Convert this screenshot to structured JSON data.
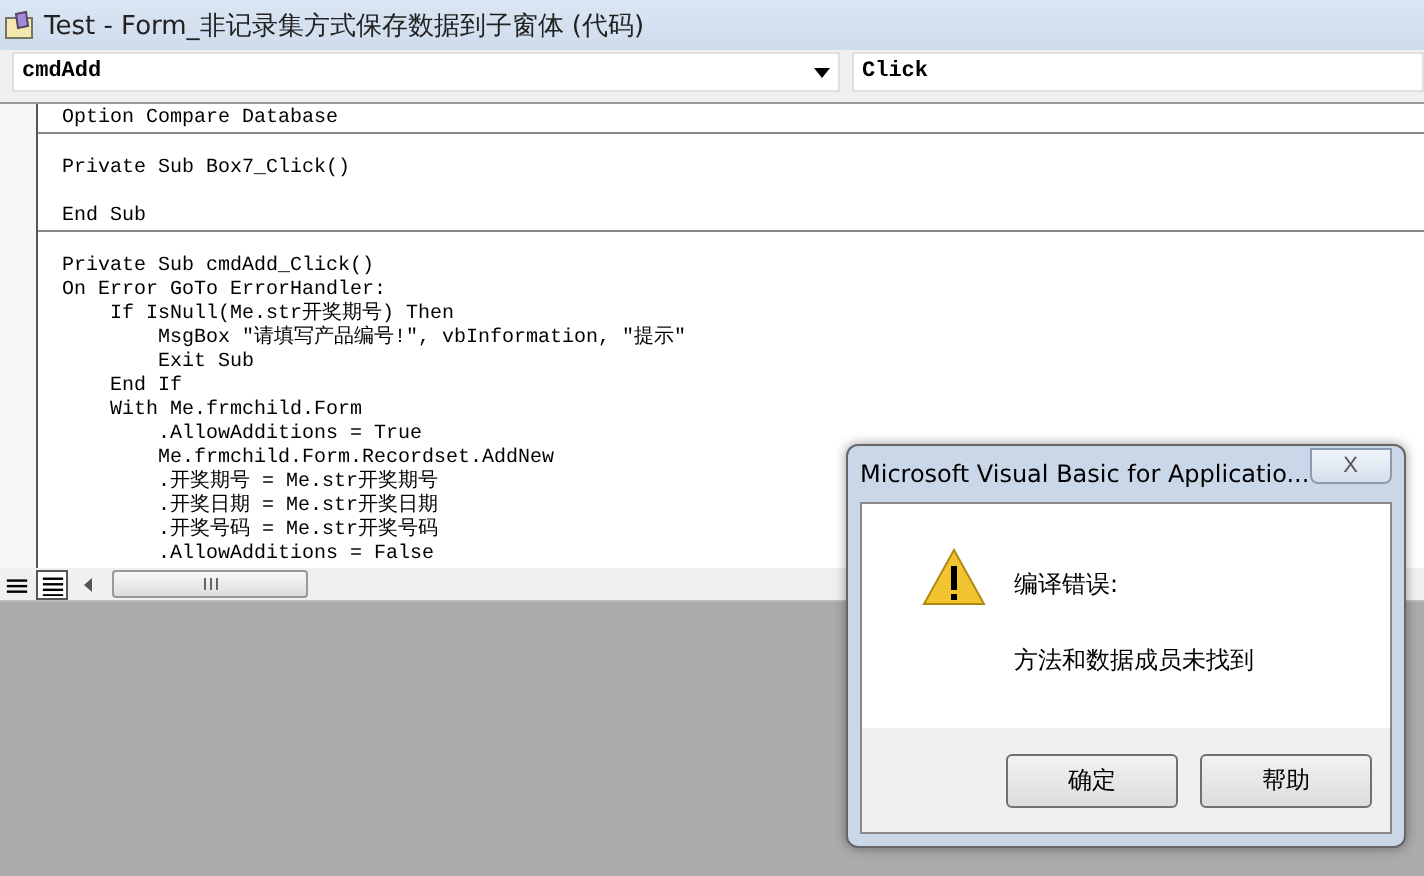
{
  "window": {
    "title": "Test - Form_非记录集方式保存数据到子窗体 (代码)"
  },
  "object_combo": {
    "value": "cmdAdd"
  },
  "procedure_combo": {
    "value": "Click"
  },
  "procedures": [
    {
      "lines": [
        {
          "kind": "code",
          "text": "Option Compare Database"
        }
      ]
    },
    {
      "lines": [
        {
          "kind": "blank"
        },
        {
          "kind": "code",
          "text": "Private Sub Box7_Click()"
        },
        {
          "kind": "blank"
        },
        {
          "kind": "code",
          "text": "End Sub"
        }
      ]
    },
    {
      "lines": [
        {
          "kind": "blank"
        },
        "Private Sub cmdAdd_Click()",
        "On Error GoTo ErrorHandler:",
        "    If IsNull(Me.str开奖期号) Then",
        "        MsgBox \"请填写产品编号!\", vbInformation, \"提示\"",
        "        Exit Sub",
        "    End If",
        "    With Me.frmchild.Form",
        "        .AllowAdditions = True",
        "        Me.frmchild.Form.Recordset.AddNew",
        "        .开奖期号 = Me.str开奖期号",
        "        .开奖日期 = Me.str开奖日期",
        "        .开奖号码 = Me.str开奖号码",
        "        .AllowAdditions = False"
      ]
    }
  ],
  "view_buttons": [
    {
      "kind": "procedure",
      "selected": false
    },
    {
      "kind": "module",
      "selected": true
    }
  ],
  "dialog": {
    "title": "Microsoft Visual Basic for Applicatio...",
    "close": "X",
    "heading": "编译错误:",
    "message": "方法和数据成员未找到",
    "buttons": [
      "确定",
      "帮助"
    ]
  }
}
